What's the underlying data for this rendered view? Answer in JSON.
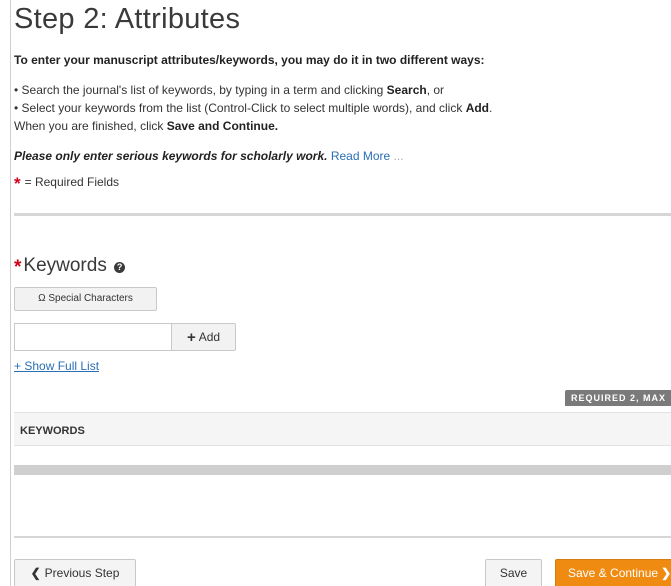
{
  "page": {
    "title": "Step 2: Attributes",
    "intro": "To enter your manuscript attributes/keywords, you may do it in two different ways:",
    "bullet1_pre": "• Search the journal's list of keywords, by typing in a term and clicking ",
    "bullet1_bold": "Search",
    "bullet1_post": ", or",
    "bullet2_pre": "• Select your keywords from the list (Control-Click to select multiple words), and click ",
    "bullet2_bold": "Add",
    "bullet2_post": ".",
    "finish_pre": "When you are finished, click ",
    "finish_bold": "Save and Continue.",
    "serious_text": "Please only enter serious keywords for scholarly work.",
    "read_more": "Read More",
    "read_more_dots": "...",
    "required_star": "*",
    "required_text": "= Required Fields"
  },
  "keywords": {
    "label": "Keywords",
    "help_icon": "?",
    "special_chars_button": "Ω Special Characters",
    "input_value": "",
    "input_placeholder": "",
    "add_button": "Add",
    "add_icon": "+",
    "show_full_list": "+ Show Full List",
    "required_badge": "REQUIRED 2, MAX",
    "table_header": "KEYWORDS"
  },
  "footer": {
    "prev_icon": "❮",
    "prev_label": "Previous Step",
    "save_label": "Save",
    "save_continue_label": "Save & Continue",
    "next_icon": "❯"
  },
  "colors": {
    "link": "#2a6fb5",
    "required": "#d0021b",
    "primary_button": "#f08b12"
  }
}
